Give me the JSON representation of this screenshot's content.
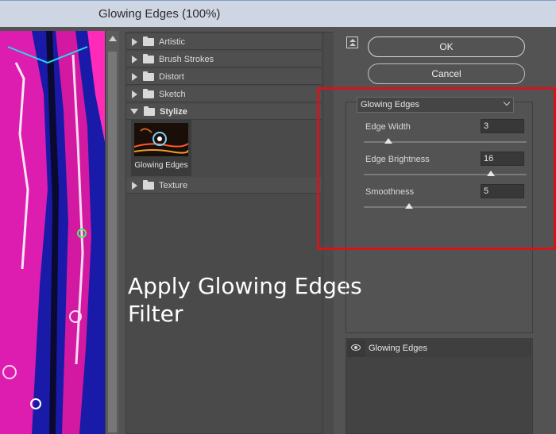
{
  "window": {
    "title": "Glowing Edges (100%)"
  },
  "filter_gallery": {
    "categories": [
      {
        "label": "Artistic",
        "expanded": false
      },
      {
        "label": "Brush Strokes",
        "expanded": false
      },
      {
        "label": "Distort",
        "expanded": false
      },
      {
        "label": "Sketch",
        "expanded": false
      },
      {
        "label": "Stylize",
        "expanded": true
      },
      {
        "label": "Texture",
        "expanded": false
      }
    ],
    "selected_thumbnail": {
      "label": "Glowing Edges"
    }
  },
  "overlay_caption": {
    "line1": "Apply Glowing Edges",
    "line2": "Filter"
  },
  "buttons": {
    "ok": "OK",
    "cancel": "Cancel"
  },
  "settings": {
    "selected_filter": "Glowing Edges",
    "params": [
      {
        "label": "Edge Width",
        "value": "3",
        "min": 1,
        "max": 14
      },
      {
        "label": "Edge Brightness",
        "value": "16",
        "min": 0,
        "max": 20
      },
      {
        "label": "Smoothness",
        "value": "5",
        "min": 1,
        "max": 15
      }
    ]
  },
  "effect_layers": [
    {
      "label": "Glowing Edges",
      "visible": true
    }
  ],
  "colors": {
    "highlight": "#d2141d",
    "preview_blue": "#1a1aa8",
    "preview_magenta": "#ff1fb0"
  }
}
